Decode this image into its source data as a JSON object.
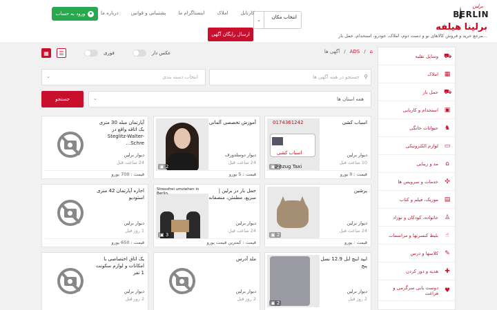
{
  "header": {
    "logo_small": "برلین",
    "logo_text": "BERLIN",
    "site_title": "برلینا هیلفه",
    "site_subtitle": "مرجع خرید و فروش کالاهای نو و دست دوم، املاک، خودرو، استخدام، حمل بار...",
    "location_select": "انتخاب مکان",
    "nav": [
      "کارتابل",
      "املاک",
      "اینستاگرام ما",
      "پشتیبانی و قوانین",
      "درباره ما"
    ],
    "login_label": "ورود به حساب",
    "free_ad_label": "ارسال رایگان آگهی"
  },
  "sidebar": [
    {
      "label": "وسایل نقلیه",
      "icon": "car-icon"
    },
    {
      "label": "املاک",
      "icon": "building-icon"
    },
    {
      "label": "حمل بار",
      "icon": "truck-icon"
    },
    {
      "label": "استخدام و کاریابی",
      "icon": "briefcase-icon"
    },
    {
      "label": "حیوانات خانگی",
      "icon": "paw-icon"
    },
    {
      "label": "لوازم الکترونیکی",
      "icon": "monitor-icon"
    },
    {
      "label": "مد و زیبایی",
      "icon": "hanger-icon"
    },
    {
      "label": "خدمات و سرویس ها",
      "icon": "wrench-icon"
    },
    {
      "label": "موزیک، فیلم و کتاب",
      "icon": "film-icon"
    },
    {
      "label": "خانواده، کودکان و نوزاد",
      "icon": "baby-icon"
    },
    {
      "label": "بلیط کنسرتها و مراسمات",
      "icon": "ticket-icon"
    },
    {
      "label": "کلاسها و درس",
      "icon": "book-icon"
    },
    {
      "label": "هدیه و دور کردن",
      "icon": "gift-icon"
    },
    {
      "label": "دوست یابی سرگرمی و فراغت",
      "icon": "heart-icon"
    }
  ],
  "breadcrumb": {
    "home": "⌂",
    "ads": "ADS",
    "current": "آگهی ها"
  },
  "filters": {
    "photo_label": "عکس دار",
    "urgent_label": "فوری",
    "search_placeholder": "جستجو در همه آگهی ها",
    "category_placeholder": "انتخاب دسته بندی",
    "state_value": "همه استان ها",
    "search_button": "جستجو"
  },
  "cards": [
    {
      "title": "اسباب کشی",
      "city": "دیوار برلین",
      "time": "10 ساعت قبل",
      "price": "قیمت : 0 یورو",
      "photo": "van",
      "count": "2",
      "van_banner": "0174361242",
      "van_badge": "اسباب کشی",
      "van_caption": "Umzug Taxi"
    },
    {
      "title": "آموزش تخصصی آلمانی",
      "city": "دیوار دوسلدورف",
      "time": "24 ساعت قبل",
      "price": "قیمت : 5 یورو",
      "photo": "woman",
      "count": "2"
    },
    {
      "title": "آپارتمان مبله 30 متری یک اتاقه واقع در Steglitz-Walter-Schre...",
      "city": "دیوار برلین",
      "time": "24 ساعت قبل",
      "price": "قیمت : 700 یورو",
      "photo": "none",
      "count": ""
    },
    {
      "title": "پرشین",
      "city": "دیوار برلین",
      "time": "24 ساعت قبل",
      "price": "قیمت : یورو",
      "photo": "cat",
      "count": "2"
    },
    {
      "title": "حمل بار در برلین | سریع، مطمئن، منصفانه",
      "city": "دیوار برلین",
      "time": "24 ساعت قبل",
      "price": "قیمت : کمترین قیمت یورو",
      "photo": "move",
      "count": "3",
      "move_stripe": "Stressfrei umziehen in Berlin."
    },
    {
      "title": "اجاره آپارتمان 42 متری استودیو",
      "city": "دیوار برلین",
      "time": "1 روز قبل",
      "price": "قیمت : 650 یورو",
      "photo": "none",
      "count": ""
    },
    {
      "title": "ایپد اینچ ایل 12.9 نسل پنج",
      "city": "دیوار برلین",
      "time": "2 روز قبل",
      "price": "",
      "photo": "ipad",
      "count": "2"
    },
    {
      "title": "ملد آدرس",
      "city": "دیوار برلین",
      "time": "2 روز قبل",
      "price": "",
      "photo": "none",
      "count": ""
    },
    {
      "title": "یک اتاق اختصاصی با امکانات و لوازم سکونت 1 نفر",
      "city": "دیوار برلین",
      "time": "2 روز قبل",
      "price": "",
      "photo": "none",
      "count": ""
    }
  ]
}
